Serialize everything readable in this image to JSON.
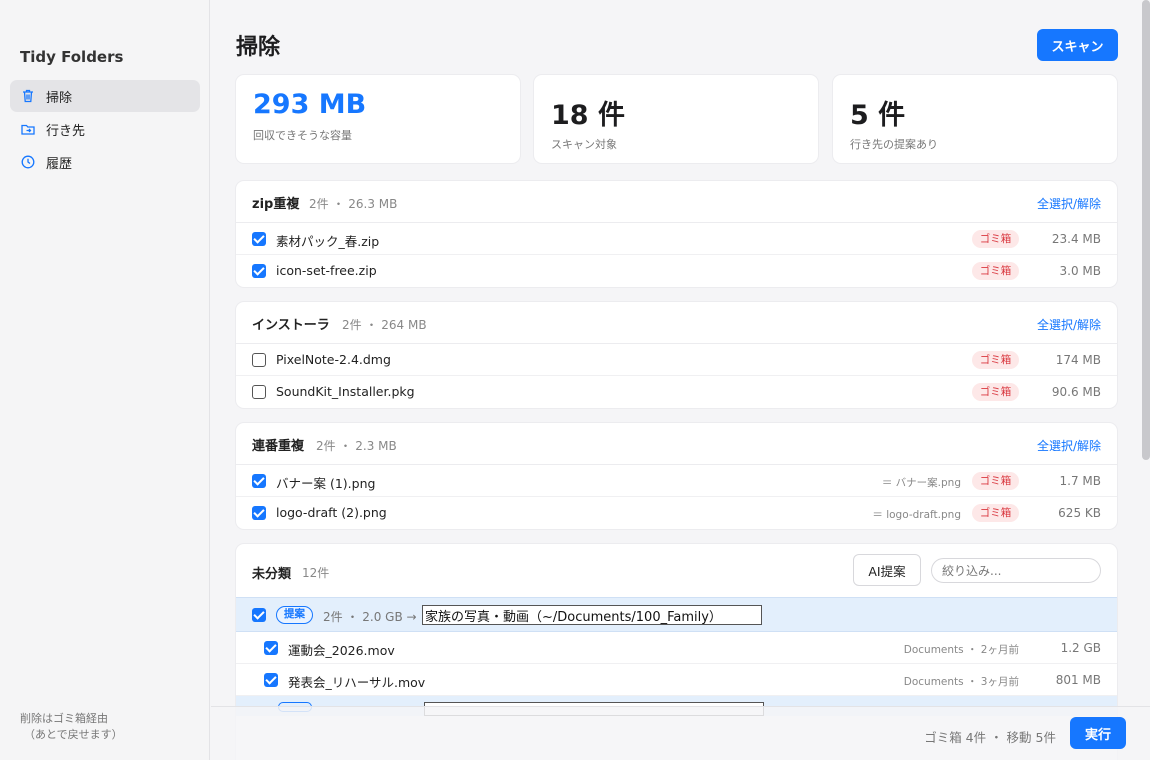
{
  "app": {
    "title": "Tidy Folders"
  },
  "sidebar": {
    "items": [
      {
        "label": "掃除",
        "icon": "trash-icon",
        "active": true
      },
      {
        "label": "行き先",
        "icon": "folder-arrow-icon",
        "active": false
      },
      {
        "label": "履歴",
        "icon": "clock-icon",
        "active": false
      }
    ],
    "note_line1": "削除はゴミ箱経由",
    "note_line2": "（あとで戻せます）"
  },
  "header": {
    "title": "掃除",
    "scan_label": "スキャン"
  },
  "stats": [
    {
      "value": "293 MB",
      "caption": "回収できそうな容量"
    },
    {
      "value": "18 件",
      "caption": "スキャン対象"
    },
    {
      "value": "5 件",
      "caption": "行き先の提案あり"
    }
  ],
  "groups": [
    {
      "title": "zip重複",
      "meta": "2件 ・ 26.3 MB",
      "select_label": "全選択/解除",
      "items": [
        {
          "name": "素材パック_春.zip",
          "checked": true,
          "badge": "ゴミ箱",
          "size": "23.4 MB"
        },
        {
          "name": "icon-set-free.zip",
          "checked": true,
          "badge": "ゴミ箱",
          "size": "3.0 MB"
        }
      ]
    },
    {
      "title": "インストーラ",
      "meta": "2件 ・ 264 MB",
      "select_label": "全選択/解除",
      "items": [
        {
          "name": "PixelNote-2.4.dmg",
          "checked": false,
          "badge": "ゴミ箱",
          "size": "174 MB"
        },
        {
          "name": "SoundKit_Installer.pkg",
          "checked": false,
          "badge": "ゴミ箱",
          "size": "90.6 MB"
        }
      ]
    },
    {
      "title": "連番重複",
      "meta": "2件 ・ 2.3 MB",
      "select_label": "全選択/解除",
      "items": [
        {
          "name": "バナー案 (1).png",
          "checked": true,
          "dup_of": "＝ バナー案.png",
          "badge": "ゴミ箱",
          "size": "1.7 MB"
        },
        {
          "name": "logo-draft (2).png",
          "checked": true,
          "dup_of": "＝ logo-draft.png",
          "badge": "ゴミ箱",
          "size": "625 KB"
        }
      ]
    }
  ],
  "unsorted": {
    "title": "未分類",
    "count": "12件",
    "ai_label": "AI提案",
    "filter_placeholder": "絞り込み...",
    "suggestion": {
      "pill": "提案",
      "meta": "2件 ・ 2.0 GB →",
      "destination": "家族の写真・動画（~/Documents/100_Family）",
      "items": [
        {
          "name": "運動会_2026.mov",
          "location": "Documents ・ 2ヶ月前",
          "size": "1.2 GB",
          "checked": true
        },
        {
          "name": "発表会_リハーサル.mov",
          "location": "Documents ・ 3ヶ月前",
          "size": "801 MB",
          "checked": true
        }
      ]
    }
  },
  "footer": {
    "summary": "ゴミ箱 4件 ・ 移動 5件",
    "run_label": "実行"
  },
  "colors": {
    "accent": "#1677ff",
    "trash_badge_bg": "#fde8e8",
    "trash_badge_fg": "#d9363e",
    "suggest_bg": "#e3effc"
  }
}
